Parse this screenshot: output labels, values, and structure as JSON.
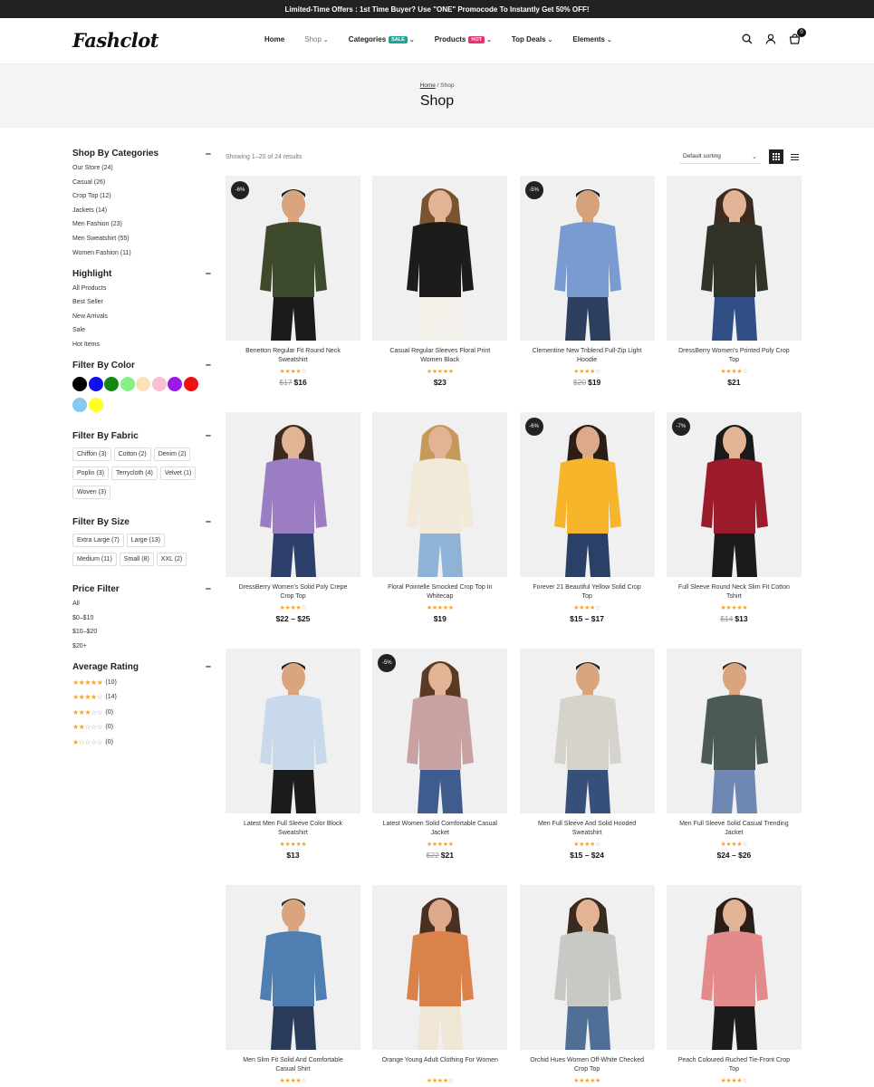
{
  "topbar": {
    "text": "Limited-Time Offers : 1st Time Buyer? Use \"ONE\" Promocode To Instantly Get 50% OFF!"
  },
  "header": {
    "logo": "Fashclot",
    "nav": [
      {
        "label": "Home",
        "chevron": false
      },
      {
        "label": "Shop",
        "chevron": true,
        "active": true
      },
      {
        "label": "Categories",
        "chevron": true,
        "badge": "SALE",
        "badge_color": "#1aa59a"
      },
      {
        "label": "Products",
        "chevron": true,
        "badge": "HOT",
        "badge_color": "#e8336d"
      },
      {
        "label": "Top Deals",
        "chevron": true
      },
      {
        "label": "Elements",
        "chevron": true
      }
    ],
    "icons": [
      "search-icon",
      "user-icon",
      "cart-icon"
    ],
    "cart_count": "0"
  },
  "banner": {
    "crumb_home": "Home",
    "crumb_sep": " / ",
    "crumb_current": "Shop",
    "title": "Shop"
  },
  "sidebar": {
    "categories": {
      "title": "Shop By Categories",
      "items": [
        "Our Store (24)",
        "Casual (26)",
        "Crop Top (12)",
        "Jackets (14)",
        "Men Fashion (23)",
        "Men Sweatshirt (55)",
        "Women Fashion (11)"
      ]
    },
    "highlight": {
      "title": "Highlight",
      "items": [
        "All Products",
        "Best Seller",
        "New Arrivals",
        "Sale",
        "Hot Items"
      ]
    },
    "color": {
      "title": "Filter By Color",
      "swatches": [
        "#000000",
        "#1010ee",
        "#118811",
        "#88ee88",
        "#fde2b8",
        "#f9bfd0",
        "#9b19e8",
        "#ee1111",
        "#87c8ee",
        "#ffff22"
      ]
    },
    "fabric": {
      "title": "Filter By Fabric",
      "items": [
        "Chiffon (3)",
        "Cotton (2)",
        "Denim (2)",
        "Poplin (3)",
        "Terrycloth (4)",
        "Velvet (1)",
        "Woven (3)"
      ]
    },
    "size": {
      "title": "Filter By Size",
      "items": [
        "Extra Large (7)",
        "Large (13)",
        "Medium (11)",
        "Small (8)",
        "XXL (2)"
      ]
    },
    "price": {
      "title": "Price Filter",
      "items": [
        "All",
        "$0–$10",
        "$10–$20",
        "$20+"
      ]
    },
    "rating": {
      "title": "Average Rating",
      "items": [
        {
          "stars": 5,
          "count": "(10)"
        },
        {
          "stars": 4,
          "count": "(14)"
        },
        {
          "stars": 3,
          "count": "(0)"
        },
        {
          "stars": 2,
          "count": "(0)"
        },
        {
          "stars": 1,
          "count": "(0)"
        }
      ]
    }
  },
  "toolbar": {
    "showing": "Showing 1–20 of 24 results",
    "sort": "Default sorting"
  },
  "products": [
    {
      "title": "Benetton Regular Fit Round Neck Sweatshirt",
      "discount": "-6%",
      "stars": 4,
      "old": "$17",
      "price": "$16",
      "shirt": "#3d4a2c",
      "pants": "#1b1b1b",
      "skin": "#d9a57f",
      "hair": "#1a1a1a"
    },
    {
      "title": "Casual Regular Sleeves Floral Print Women Black",
      "discount": "",
      "stars": 5,
      "old": "",
      "price": "$23",
      "shirt": "#1e1b1b",
      "pants": "#f4f0ea",
      "skin": "#e2b394",
      "hair": "#7a5330"
    },
    {
      "title": "Clementine New Triblend Full-Zip Light Hoodie",
      "discount": "-5%",
      "stars": 4,
      "old": "$20",
      "price": "$19",
      "shirt": "#7a9bd0",
      "pants": "#2d3f5e",
      "skin": "#d6a27c",
      "hair": "#1a1a1a"
    },
    {
      "title": "DressBerry Women's Printed Poly Crop Top",
      "discount": "",
      "stars": 4,
      "old": "",
      "price": "$21",
      "shirt": "#2f3328",
      "pants": "#2f4f86",
      "skin": "#e2b394",
      "hair": "#3a2a1f"
    },
    {
      "title": "DressBerry Women's Solid Poly Crepe Crop Top",
      "discount": "",
      "stars": 4,
      "old": "",
      "price": "$22 – $25",
      "shirt": "#9b7dc3",
      "pants": "#2b3f6a",
      "skin": "#e2b394",
      "hair": "#3a2a1f"
    },
    {
      "title": "Floral Pointelle Smocked Crop Top In Whitecap",
      "discount": "",
      "stars": 5,
      "old": "",
      "price": "$19",
      "shirt": "#f2ead8",
      "pants": "#8fb3d6",
      "skin": "#e2b394",
      "hair": "#c49a5a"
    },
    {
      "title": "Forever 21 Beautiful Yellow Solid Crop Top",
      "discount": "-6%",
      "stars": 4,
      "old": "",
      "price": "$15 – $17",
      "shirt": "#f7b52b",
      "pants": "#2b4066",
      "skin": "#dca98a",
      "hair": "#2a1e17"
    },
    {
      "title": "Full Sleeve Round Neck Slim Fit Cotton Tshirt",
      "discount": "-7%",
      "stars": 5,
      "old": "$14",
      "price": "$13",
      "shirt": "#9c1c2c",
      "pants": "#1b1b1b",
      "skin": "#e2b394",
      "hair": "#1a1a1a"
    },
    {
      "title": "Latest Men Full Sleeve Color Block Sweatshirt",
      "discount": "",
      "stars": 5,
      "old": "",
      "price": "$13",
      "shirt": "#c9d9ec",
      "pants": "#1b1b1b",
      "skin": "#d9a57f",
      "hair": "#2a1e17"
    },
    {
      "title": "Latest Women Solid Comfortable Casual Jacket",
      "discount": "-5%",
      "stars": 5,
      "old": "$22",
      "price": "$21",
      "shirt": "#c9a3a3",
      "pants": "#3e5d8e",
      "skin": "#e2b394",
      "hair": "#5a3a22"
    },
    {
      "title": "Men Full Sleeve And Solid Hooded Sweatshirt",
      "discount": "",
      "stars": 4,
      "old": "",
      "price": "$15 – $24",
      "shirt": "#d6d2cc",
      "pants": "#36507a",
      "skin": "#d9a57f",
      "hair": "#1a1a1a"
    },
    {
      "title": "Men Full Sleeve Solid Casual Trending Jacket",
      "discount": "",
      "stars": 4,
      "old": "",
      "price": "$24 – $26",
      "shirt": "#4b5a52",
      "pants": "#6f88b3",
      "skin": "#d9a57f",
      "hair": "#3a2a1f"
    },
    {
      "title": "Men Slim Fit Solid And Comfortable Casual Shirt",
      "discount": "",
      "stars": 4,
      "old": "",
      "price": "",
      "shirt": "#4f7fb0",
      "pants": "#2b3b5a",
      "skin": "#d9a57f",
      "hair": "#3a2a1f"
    },
    {
      "title": "Orange Young Adult Clothing For Women",
      "discount": "",
      "stars": 4,
      "old": "",
      "price": "",
      "shirt": "#d9834a",
      "pants": "#efe6d6",
      "skin": "#dca98a",
      "hair": "#4a3020"
    },
    {
      "title": "Orchid Hues Women Off-White Checked Crop Top",
      "discount": "",
      "stars": 5,
      "old": "",
      "price": "",
      "shirt": "#c8c8c4",
      "pants": "#4f6f96",
      "skin": "#e2b394",
      "hair": "#3a2a1f"
    },
    {
      "title": "Peach Coloured Ruched Tie-Front Crop Top",
      "discount": "",
      "stars": 4,
      "old": "",
      "price": "",
      "shirt": "#e38a8a",
      "pants": "#1b1b1b",
      "skin": "#e2b394",
      "hair": "#2a1e17"
    }
  ]
}
